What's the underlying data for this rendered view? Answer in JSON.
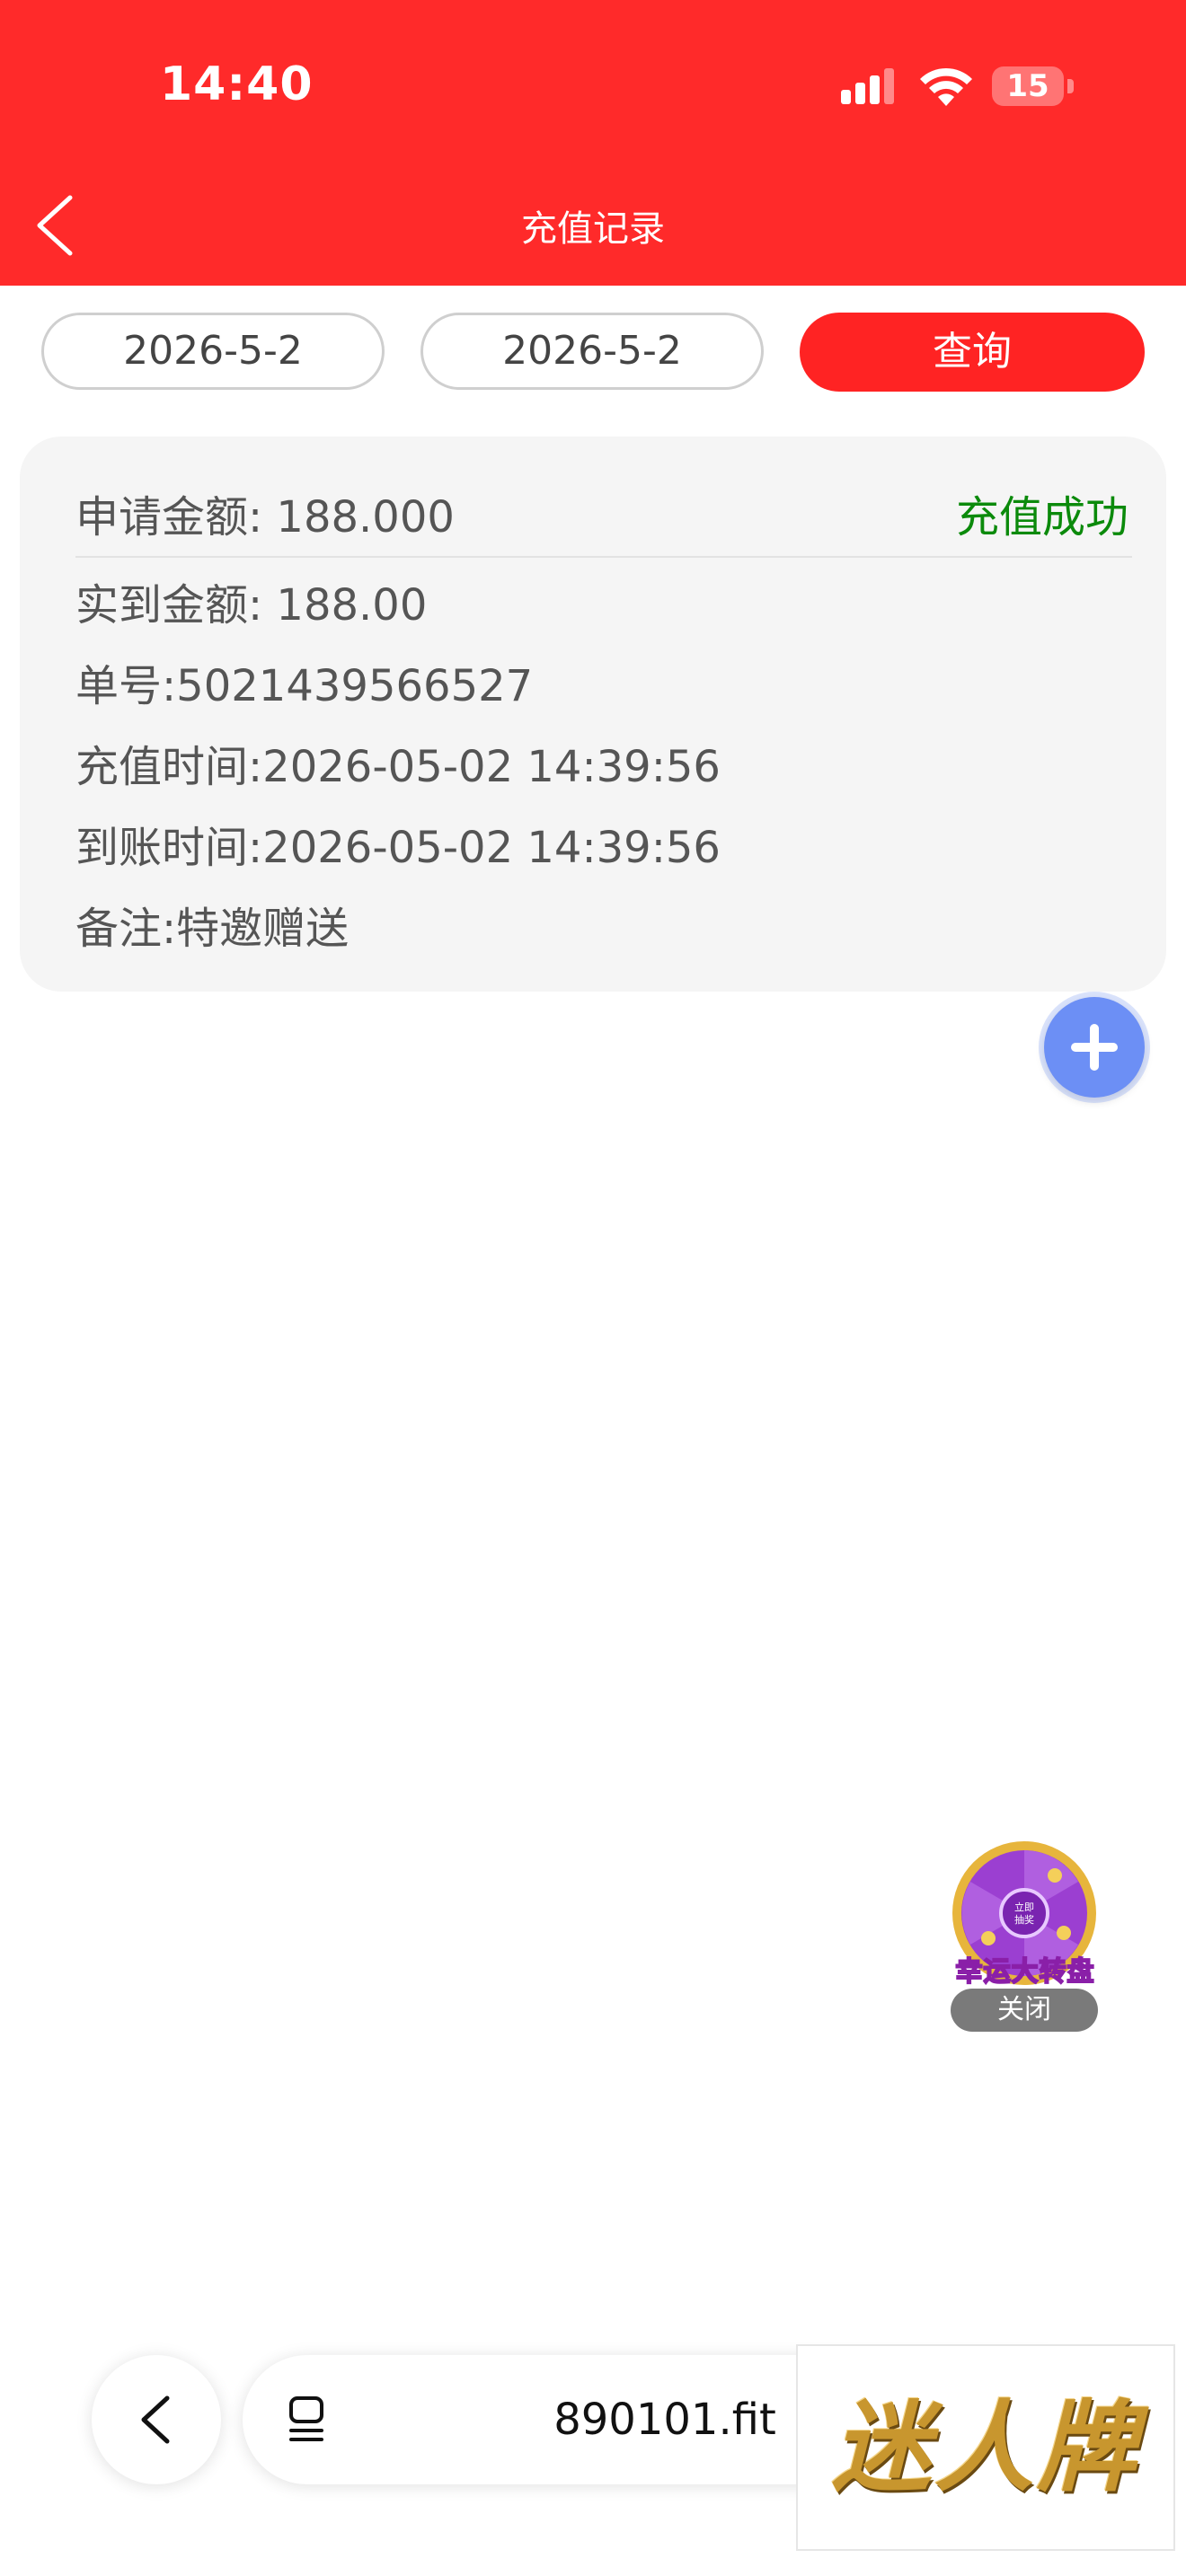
{
  "status_bar": {
    "time": "14:40",
    "battery": "15"
  },
  "header": {
    "title": "充值记录"
  },
  "filter": {
    "start_date": "2026-5-2",
    "end_date": "2026-5-2",
    "query_label": "查询"
  },
  "record": {
    "apply_amount": "申请金额: 188.000",
    "status": "充值成功",
    "actual_amount": "实到金额: 188.00",
    "order_no": "单号:5021439566527",
    "recharge_time": "充值时间:2026-05-02 14:39:56",
    "arrival_time": "到账时间:2026-05-02 14:39:56",
    "remark": "备注:特邀赠送"
  },
  "promo": {
    "wheel_center": "立即抽奖",
    "wheel_title": "幸运大转盘",
    "close_label": "关闭"
  },
  "browser": {
    "url": "890101.fit"
  },
  "ad": {
    "logo_text": "迷人牌"
  },
  "colors": {
    "header_bg": "#FF2A2A",
    "primary_red": "#FF2323",
    "success_green": "#0B8A0B",
    "fab_blue": "#6C8FF5",
    "card_bg": "#F5F5F5"
  }
}
